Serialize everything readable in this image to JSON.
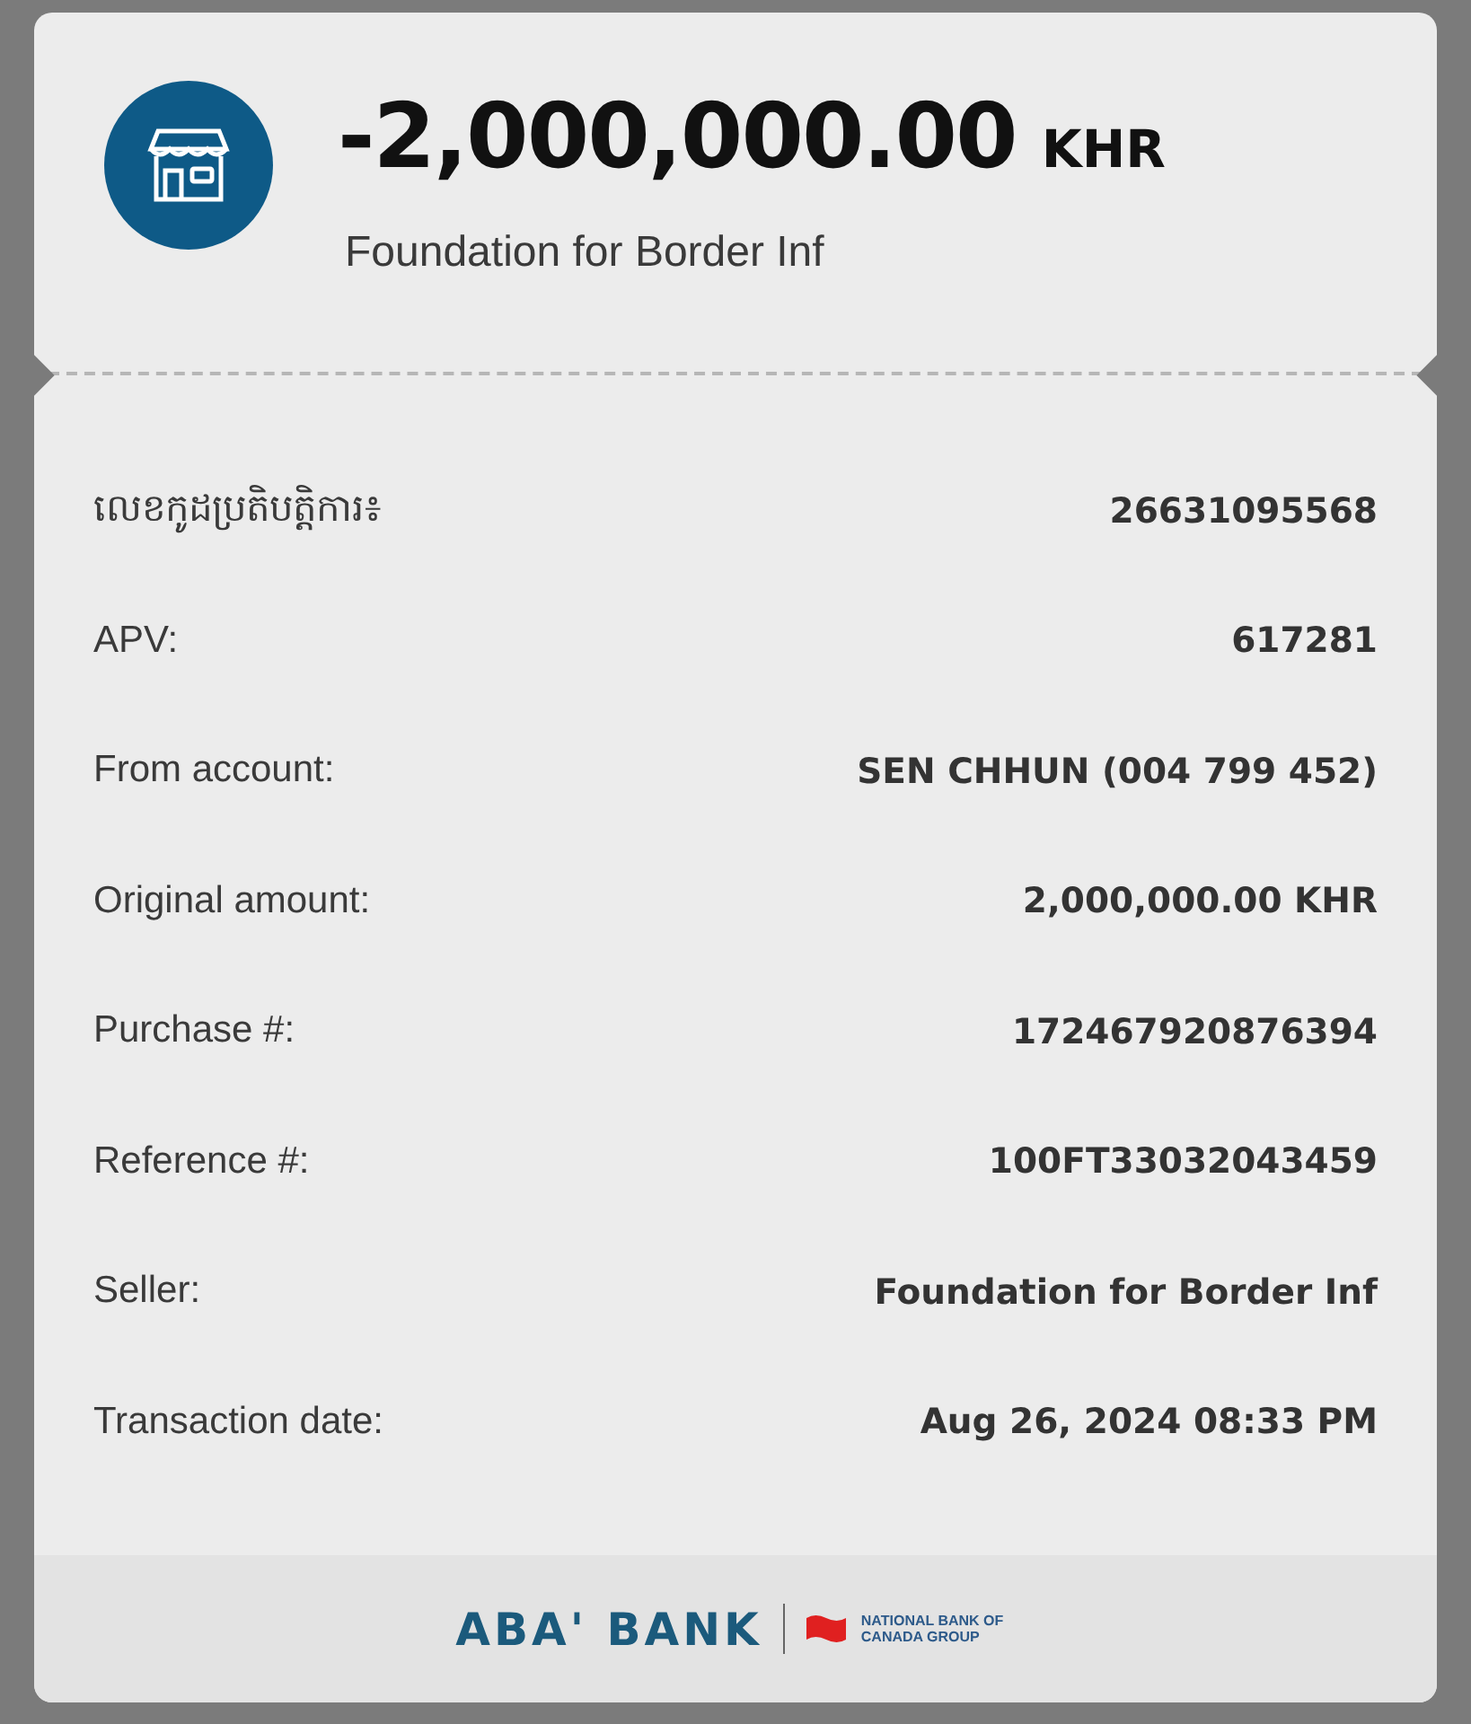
{
  "header": {
    "amount": "-2,000,000.00",
    "currency": "KHR",
    "merchant": "Foundation for Border Inf"
  },
  "details": [
    {
      "label": "លេខកូដប្រតិបត្តិការ៖",
      "value": "26631095568"
    },
    {
      "label": "APV:",
      "value": "617281"
    },
    {
      "label": "From account:",
      "value": "SEN CHHUN (004 799 452)"
    },
    {
      "label": "Original amount:",
      "value": "2,000,000.00 KHR"
    },
    {
      "label": "Purchase #:",
      "value": "172467920876394"
    },
    {
      "label": "Reference #:",
      "value": "100FT33032043459"
    },
    {
      "label": "Seller:",
      "value": "Foundation for Border Inf"
    },
    {
      "label": "Transaction date:",
      "value": "Aug 26, 2024 08:33 PM"
    }
  ],
  "footer": {
    "bank_name": "ABA' BANK",
    "group_name": "NATIONAL BANK OF CANADA GROUP"
  }
}
